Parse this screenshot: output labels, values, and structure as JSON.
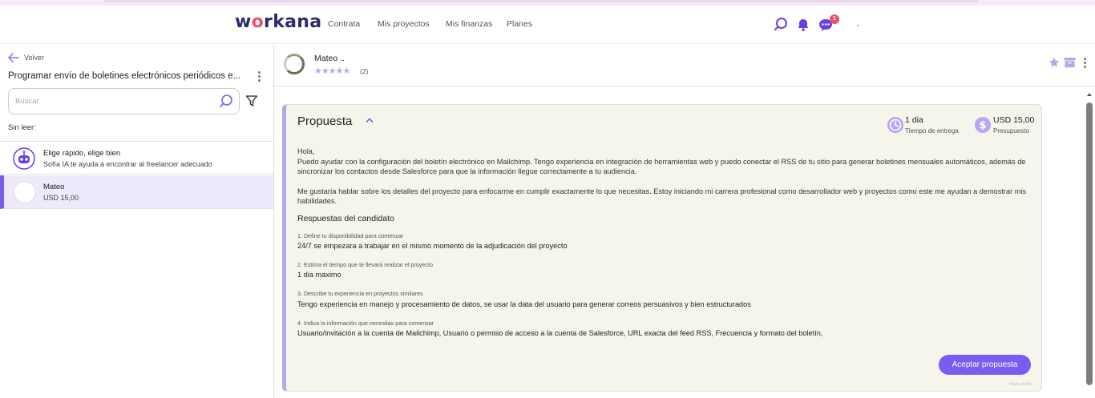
{
  "header": {
    "logo": "workana",
    "nav": [
      "Contrata",
      "Mis proyectos",
      "Mis finanzas",
      "Planes"
    ],
    "notification_badge": "1",
    "user_name": ","
  },
  "sidebar": {
    "back_label": "Volver",
    "project_title": "Programar envío de boletines electrónicos periódicos e...",
    "search_placeholder": "Buscar",
    "unread_label": "Sin leer:",
    "conversations": [
      {
        "title": "Elige rápido, elige bien",
        "subtitle": "Sofía IA te ayuda a encontrar al freelancer adecuado"
      },
      {
        "title": "Mateo",
        "subtitle": "USD 15,00"
      }
    ]
  },
  "chat": {
    "name": "Mateo ..",
    "stars": "★★★★★",
    "rating_count": "(2)"
  },
  "proposal": {
    "title": "Propuesta",
    "delivery_value": "1 dia",
    "delivery_label": "Tiempo de entrega",
    "budget_value": "USD 15,00",
    "budget_label": "Presupuesto",
    "greeting": "Hola,",
    "para1": "Puedo ayudar con la configuración del boletín electrónico en Mailchimp. Tengo experiencia en integración de herramientas web y puedo conectar el RSS de tu sitio para generar boletines mensuales automáticos, además de sincronizar los contactos desde Salesforce para que la información llegue correctamente a tu audiencia.",
    "para2": "Me gustaría hablar sobre los detalles del proyecto para enfocarme en cumplir exactamente lo que necesitas. Estoy iniciando mi carrera profesional como desarrollador web y proyectos como este me ayudan a demostrar mis habilidades.",
    "responses_title": "Respuestas del candidato",
    "responses": [
      {
        "q": "1. Define tu disponibilidad para comenzar",
        "a": "24/7 se empezara a trabajar en el mismo momento de la adjudicación del proyecto"
      },
      {
        "q": "2. Estima el tiempo que te llevará realizar el proyecto",
        "a": "1 dia maximo"
      },
      {
        "q": "3. Describe tu experiencia en proyectos similares",
        "a": "Tengo experiencia en manejo y procesamiento de datos, se usar la data del usuario para generar correos persuasivos y bien estructurados"
      },
      {
        "q": "4. Indica la información que necesitas para comenzar",
        "a": "Usuario/invitación a la cuenta de Mailchimp, Usuario o permiso de acceso a la cuenta de Salesforce, URL exacta del feed RSS, Frecuencia y formato del boletín,"
      }
    ],
    "accept_label": "Aceptar propuesta",
    "timestamp": "Hace un año"
  },
  "colors": {
    "accent": "#7a5df0",
    "accent_light": "#b5a7ea",
    "brand_dark": "#2b2b6b",
    "badge": "#e9516c"
  }
}
